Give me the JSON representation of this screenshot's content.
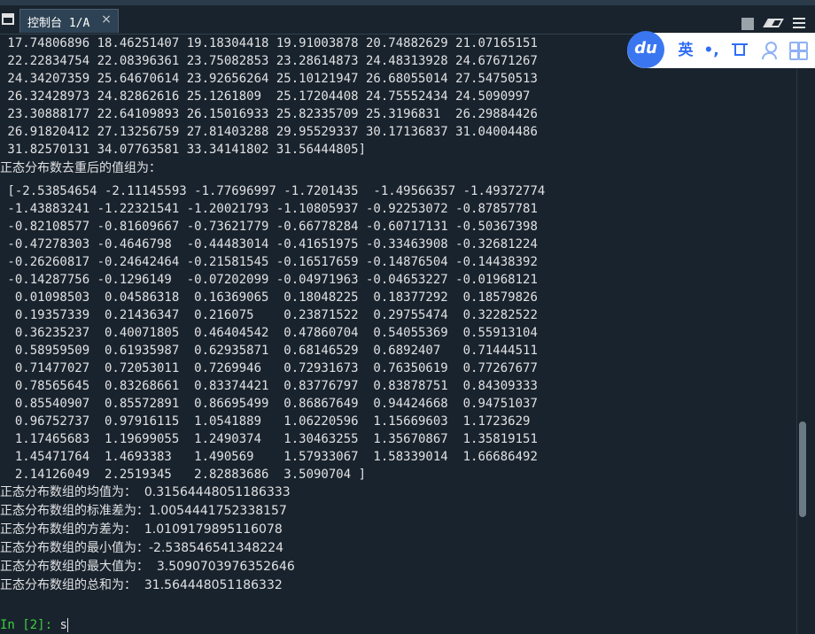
{
  "tab": {
    "label": "控制台 1/A",
    "close": "×"
  },
  "ime": {
    "logo": "du",
    "lang": "英",
    "punct": "•,"
  },
  "console_lines": [
    " 17.74806896 18.46251407 19.18304418 19.91003878 20.74882629 21.07165151",
    " 22.22834754 22.08396361 23.75082853 23.28614873 24.48313928 24.67671267",
    " 24.34207359 25.64670614 23.92656264 25.10121947 26.68055014 27.54750513",
    " 26.32428973 24.82862616 25.1261809  25.17204408 24.75552434 24.5090997",
    " 23.30888177 22.64109893 26.15016933 25.82335709 25.3196831  26.29884426",
    " 26.91820412 27.13256759 27.81403288 29.95529337 30.17136837 31.04004486",
    " 31.82570131 34.07763581 33.34141802 31.56444805]",
    "正态分布数去重后的值组为：",
    " [-2.53854654 -2.11145593 -1.77696997 -1.7201435  -1.49566357 -1.49372774",
    " -1.43883241 -1.22321541 -1.20021793 -1.10805937 -0.92253072 -0.87857781",
    " -0.82108577 -0.81609667 -0.73621779 -0.66778284 -0.60717131 -0.50367398",
    " -0.47278303 -0.4646798  -0.44483014 -0.41651975 -0.33463908 -0.32681224",
    " -0.26260817 -0.24642464 -0.21581545 -0.16517659 -0.14876504 -0.14438392",
    " -0.14287756 -0.1296149  -0.07202099 -0.04971963 -0.04653227 -0.01968121",
    "  0.01098503  0.04586318  0.16369065  0.18048225  0.18377292  0.18579826",
    "  0.19357339  0.21436347  0.216075    0.23871522  0.29755474  0.32282522",
    "  0.36235237  0.40071805  0.46404542  0.47860704  0.54055369  0.55913104",
    "  0.58959509  0.61935987  0.62935871  0.68146529  0.6892407   0.71444511",
    "  0.71477027  0.72053011  0.7269946   0.72931673  0.76350619  0.77267677",
    "  0.78565645  0.83268661  0.83374421  0.83776797  0.83878751  0.84309333",
    "  0.85540907  0.85572891  0.86695499  0.86867649  0.94424668  0.94751037",
    "  0.96752737  0.97916115  1.0541889   1.06220596  1.15669603  1.1723629",
    "  1.17465683  1.19699055  1.2490374   1.30463255  1.35670867  1.35819151",
    "  1.45471764  1.4693383   1.490569    1.57933067  1.58339014  1.66686492",
    "  2.14126049  2.2519345   2.82883686  3.5090704 ]",
    "正态分布数组的均值为：  0.31564448051186333",
    "正态分布数组的标准差为：1.0054441752338157",
    "正态分布数组的方差为：  1.0109179895116078",
    "正态分布数组的最小值为：-2.538546541348224",
    "正态分布数组的最大值为：  3.5090703976352646",
    "正态分布数组的总和为：  31.564448051186332"
  ],
  "prompt": {
    "label": "In [2]:",
    "input": "s"
  }
}
